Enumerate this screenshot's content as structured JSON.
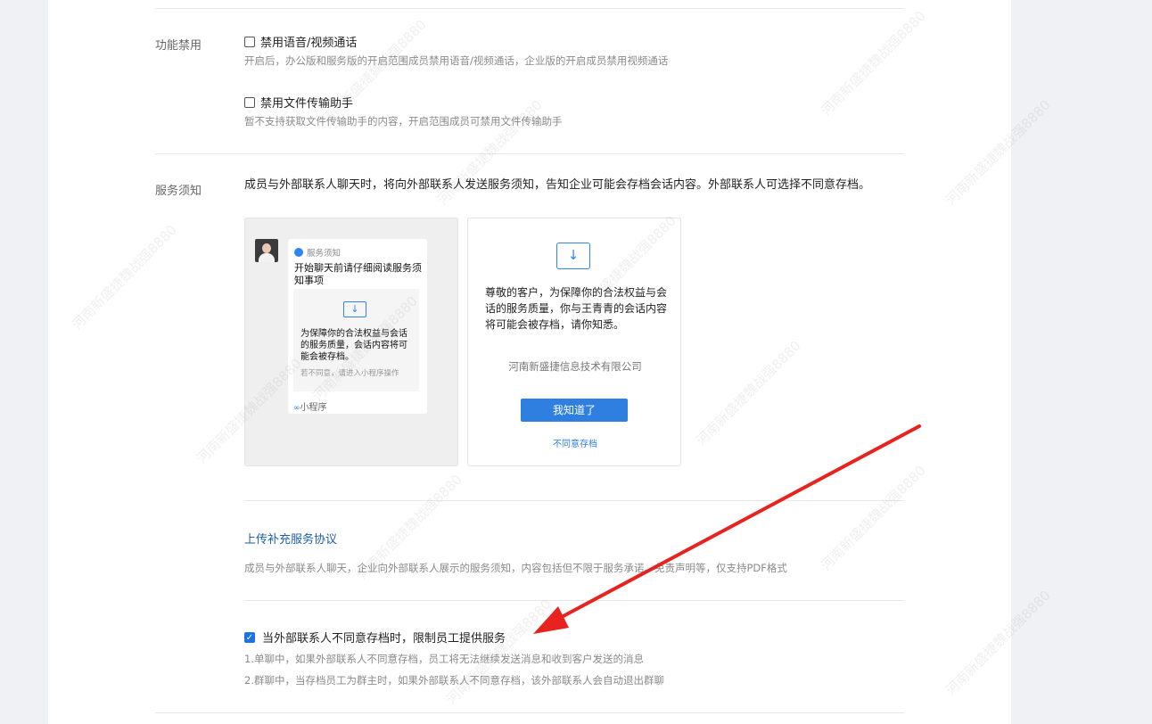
{
  "features": {
    "label": "功能禁用",
    "disable_voice": {
      "label": "禁用语音/视频通话",
      "checked": false,
      "hint": "开启后，办公版和服务版的开启范围成员禁用语音/视频通话，企业版的开启成员禁用视频通话"
    },
    "disable_file_helper": {
      "label": "禁用文件传输助手",
      "checked": false,
      "hint": "暂不支持获取文件传输助手的内容，开启范围成员可禁用文件传输助手"
    }
  },
  "service_notice": {
    "label": "服务须知",
    "description": "成员与外部联系人聊天时，将向外部联系人发送服务须知，告知企业可能会存档会话内容。外部联系人可选择不同意存档。",
    "left_preview": {
      "header": "服务须知",
      "title": "开始聊天前请仔细阅读服务须知事项",
      "card_text": "为保障你的合法权益与会话的服务质量，会话内容将可能会被存档。",
      "card_sub": "若不同意，请进入小程序操作",
      "mini_program": "小程序"
    },
    "right_preview": {
      "text": "尊敬的客户，为保障你的合法权益与会话的服务质量，你与王青青的会话内容将可能会被存档，请你知悉。",
      "company": "河南新盛捷信息技术有限公司",
      "button": "我知道了",
      "disagree": "不同意存档"
    },
    "upload_link": "上传补充服务协议",
    "upload_hint": "成员与外部联系人聊天，企业向外部联系人展示的服务须知，内容包括但不限于服务承诺、免责声明等，仅支持PDF格式",
    "restrict": {
      "label": "当外部联系人不同意存档时，限制员工提供服务",
      "checked": true,
      "rule1": "1.单聊中，如果外部联系人不同意存档，员工将无法继续发送消息和收到客户发送的消息",
      "rule2": "2.群聊中，当存档员工为群主时，如果外部联系人不同意存档，该外部联系人会自动退出群聊"
    }
  },
  "watermark_text": "河南新盛捷魏战强8880",
  "colors": {
    "accent": "#2f7fe0",
    "link": "#1c5fa8",
    "arrow": "#e8231f"
  }
}
